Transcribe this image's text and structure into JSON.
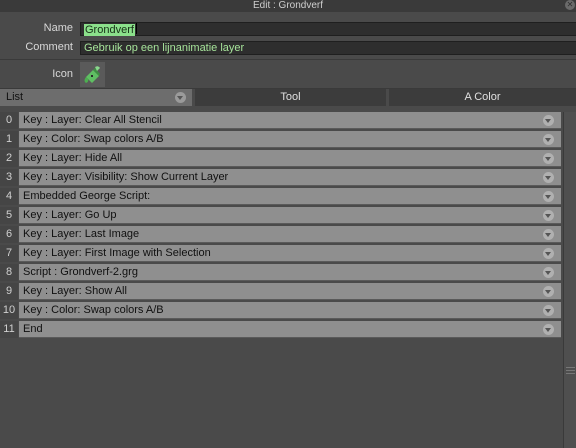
{
  "window": {
    "title": "Edit : Grondverf"
  },
  "fields": {
    "name_label": "Name",
    "name_value": "Grondverf",
    "comment_label": "Comment",
    "comment_value": "Gebruik op een lijnanimatie layer",
    "icon_label": "Icon",
    "icon_name": "paint-bucket-icon"
  },
  "tabs": {
    "list": "List",
    "tool": "Tool",
    "color": "A Color"
  },
  "items": [
    {
      "num": "0",
      "label": "Key : Layer: Clear All Stencil"
    },
    {
      "num": "1",
      "label": "Key : Color: Swap colors A/B"
    },
    {
      "num": "2",
      "label": "Key : Layer: Hide All"
    },
    {
      "num": "3",
      "label": "Key : Layer: Visibility: Show Current Layer"
    },
    {
      "num": "4",
      "label": "Embedded George Script:"
    },
    {
      "num": "5",
      "label": "Key : Layer: Go Up"
    },
    {
      "num": "6",
      "label": "Key : Layer: Last Image"
    },
    {
      "num": "7",
      "label": "Key : Layer: First Image with Selection"
    },
    {
      "num": "8",
      "label": "Script : Grondverf-2.grg"
    },
    {
      "num": "9",
      "label": "Key : Layer: Show All"
    },
    {
      "num": "10",
      "label": "Key : Color: Swap colors A/B"
    },
    {
      "num": "11",
      "label": "End"
    }
  ],
  "colors": {
    "name_highlight": "#8be08b",
    "comment_text": "#a6e39a",
    "icon_green": "#4caf50"
  }
}
